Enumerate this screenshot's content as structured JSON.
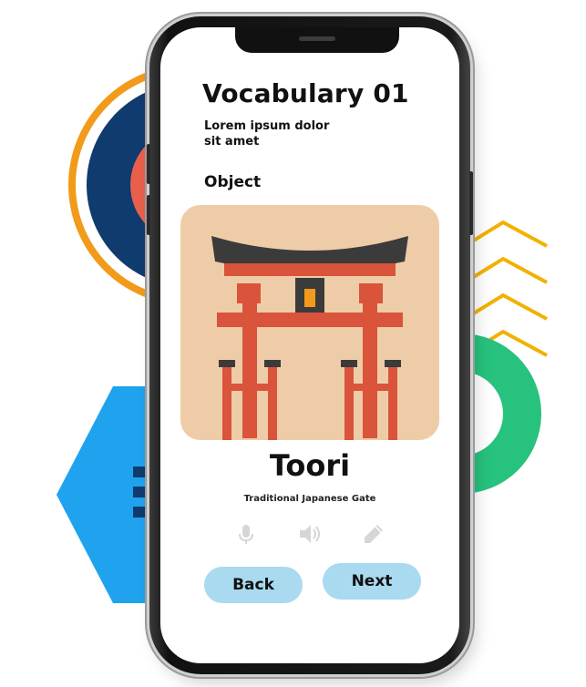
{
  "lesson": {
    "title": "Vocabulary 01",
    "subtitle": "Lorem ipsum dolor sit amet",
    "category_label": "Object"
  },
  "card": {
    "image_icon": "torii-gate-illustration",
    "word": "Toori",
    "meaning": "Traditional Japanese Gate"
  },
  "actions": {
    "icons": [
      "microphone-icon",
      "speaker-icon",
      "pencil-icon"
    ]
  },
  "navigation": {
    "back_label": "Back",
    "next_label": "Next"
  },
  "colors": {
    "button_bg": "#a9daf0",
    "card_bg": "#efcca8",
    "gate_red": "#d9543a",
    "roof_dark": "#3b3b3b",
    "accent_orange": "#f29a1a",
    "accent_navy": "#0f3b6e",
    "accent_blue": "#1fa3ee",
    "accent_green": "#27c27d",
    "accent_yellow": "#f2b100"
  }
}
